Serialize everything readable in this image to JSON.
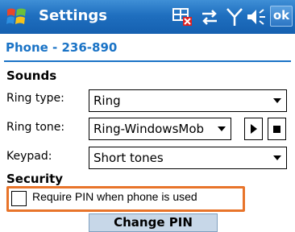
{
  "titlebar": {
    "title": "Settings",
    "ok_label": "ok",
    "start_icon": "windows-flag-icon",
    "tray_icons": [
      "connectivity-icon",
      "data-arrows-icon",
      "signal-antenna-icon",
      "volume-icon"
    ]
  },
  "header": {
    "title": "Phone - 236-890"
  },
  "sounds": {
    "heading": "Sounds",
    "ring_type": {
      "label": "Ring type:",
      "value": "Ring"
    },
    "ring_tone": {
      "label": "Ring tone:",
      "value": "Ring-WindowsMob"
    },
    "keypad": {
      "label": "Keypad:",
      "value": "Short tones"
    }
  },
  "security": {
    "heading": "Security",
    "require_pin": {
      "label": "Require PIN when phone is used",
      "checked": false
    },
    "change_pin_label": "Change PIN"
  },
  "colors": {
    "titlebar": "#1f6fbf",
    "accent": "#1a73c6",
    "highlight": "#e8742a",
    "button": "#c7d7e8"
  }
}
